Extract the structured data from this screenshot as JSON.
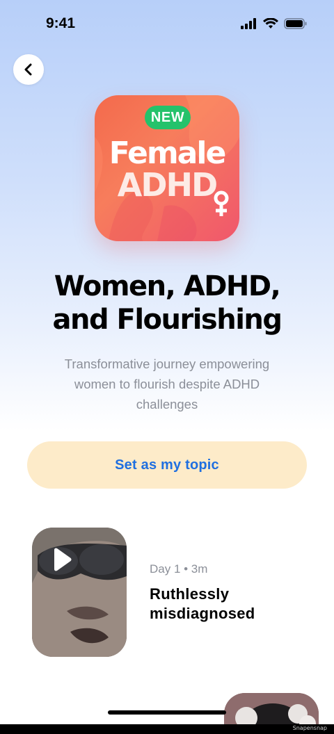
{
  "status_bar": {
    "time": "9:41"
  },
  "hero": {
    "badge": "NEW",
    "line1": "Female",
    "line2": "ADHD"
  },
  "title_lines": [
    "Women, ADHD,",
    "and Flourishing"
  ],
  "subtitle_lines": [
    "Transformative journey empowering",
    "women to flourish despite ADHD",
    "challenges"
  ],
  "topic_button": {
    "label": "Set as my topic"
  },
  "lessons": [
    {
      "meta": "Day 1 • 3m",
      "title_lines": [
        "Ruthlessly",
        "misdiagnosed"
      ]
    }
  ],
  "watermark": "Snapensnap",
  "colors": {
    "accent_blue": "#1f6fe0",
    "button_bg": "#fdebc9",
    "badge_green": "#25c26b",
    "hero_coral": "#f36a4c"
  }
}
